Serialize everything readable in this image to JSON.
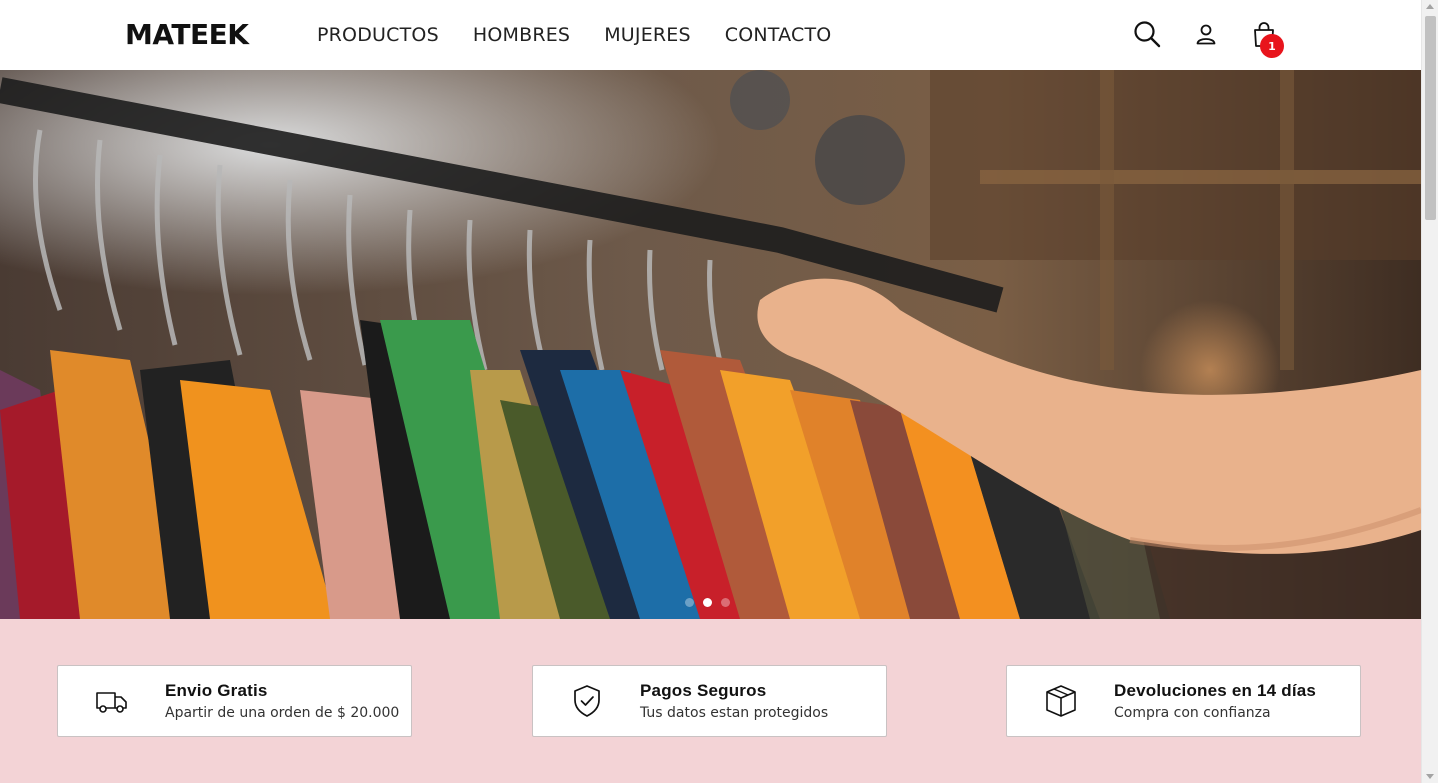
{
  "header": {
    "logo": "MATEEK",
    "nav": [
      "PRODUCTOS",
      "HOMBRES",
      "MUJERES",
      "CONTACTO"
    ],
    "icons": [
      "search-icon",
      "user-icon",
      "shopping-bag-icon"
    ],
    "cart_count": "1",
    "badge_color": "#e8141c"
  },
  "hero": {
    "image": "clothing-rack-photo",
    "slides_total": 3,
    "active_slide": 2
  },
  "features": {
    "background": "#f3d3d6",
    "items": [
      {
        "icon": "truck-icon",
        "title": "Envio Gratis",
        "subtitle": "Apartir de una orden de $ 20.000"
      },
      {
        "icon": "shield-check-icon",
        "title": "Pagos Seguros",
        "subtitle": "Tus datos estan protegidos"
      },
      {
        "icon": "box-icon",
        "title": "Devoluciones en 14 días",
        "subtitle": "Compra con confianza"
      }
    ]
  }
}
